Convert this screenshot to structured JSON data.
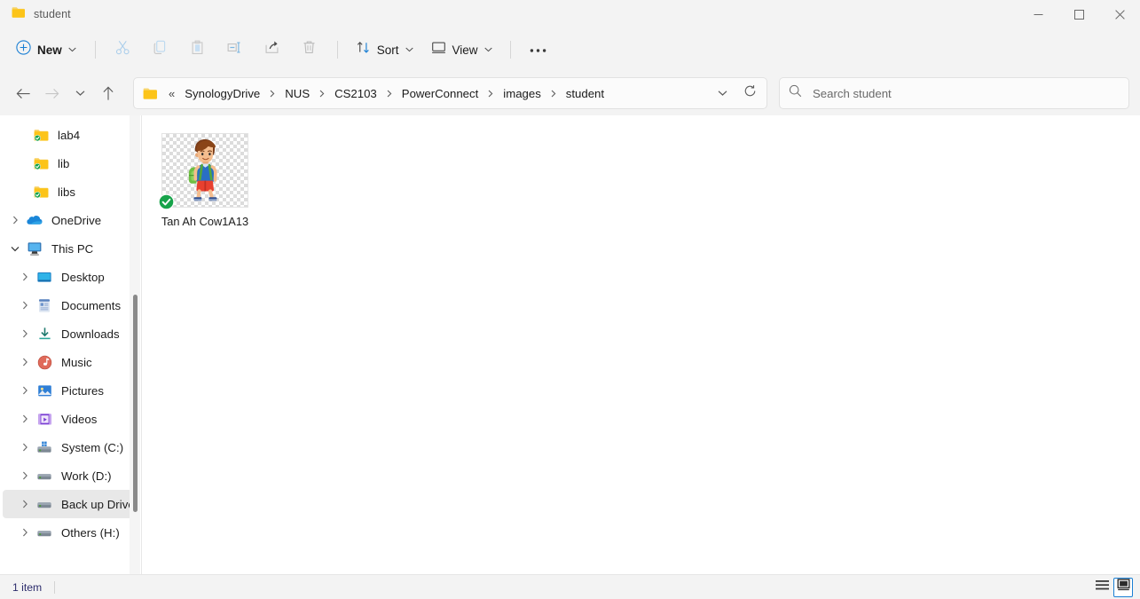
{
  "window": {
    "title": "student",
    "folder_icon": "folder-icon",
    "controls": [
      {
        "name": "minimize",
        "glyph": "—"
      },
      {
        "name": "maximize",
        "glyph": "☐"
      },
      {
        "name": "close",
        "glyph": "✕"
      }
    ]
  },
  "toolbar": {
    "new_label": "New",
    "new_icon": "circle-plus-icon",
    "items": [
      {
        "name": "cut",
        "icon": "scissors-icon",
        "label": "Cut"
      },
      {
        "name": "copy",
        "icon": "copy-icon",
        "label": "Copy"
      },
      {
        "name": "paste",
        "icon": "paste-icon",
        "label": "Paste"
      },
      {
        "name": "rename",
        "icon": "rename-icon",
        "label": "Rename"
      },
      {
        "name": "share",
        "icon": "share-icon",
        "label": "Share"
      },
      {
        "name": "delete",
        "icon": "trash-icon",
        "label": "Delete"
      }
    ],
    "sort_label": "Sort",
    "sort_icon": "sort-arrows-icon",
    "view_label": "View",
    "view_icon": "monitor-icon",
    "more_label": "See more",
    "more_icon": "ellipsis-icon"
  },
  "navigation": {
    "back": {
      "name": "back",
      "enabled": true
    },
    "forward": {
      "name": "forward",
      "enabled": false
    },
    "recent": {
      "name": "recent-locations",
      "enabled": true
    },
    "up": {
      "name": "up-one-level",
      "enabled": true
    }
  },
  "address": {
    "folder_icon": "folder-icon",
    "overflow": "«",
    "crumbs": [
      "SynologyDrive",
      "NUS",
      "CS2103",
      "PowerConnect",
      "images",
      "student"
    ],
    "separator": "›",
    "dropdown_icon": "chevron-down-icon",
    "refresh_icon": "refresh-icon"
  },
  "search": {
    "icon": "search-icon",
    "placeholder": "Search student",
    "value": ""
  },
  "sidebar": {
    "items": [
      {
        "label": "lab4",
        "icon": "folder-sync-icon",
        "indent": 2,
        "twisty": "none",
        "state": "normal"
      },
      {
        "label": "lib",
        "icon": "folder-sync-icon",
        "indent": 2,
        "twisty": "none",
        "state": "normal"
      },
      {
        "label": "libs",
        "icon": "folder-sync-icon",
        "indent": 2,
        "twisty": "none",
        "state": "normal"
      },
      {
        "label": "OneDrive",
        "icon": "onedrive-cloud-icon",
        "indent": 0,
        "twisty": "collapsed",
        "state": "normal"
      },
      {
        "label": "This PC",
        "icon": "this-pc-icon",
        "indent": 0,
        "twisty": "expanded",
        "state": "normal"
      },
      {
        "label": "Desktop",
        "icon": "desktop-icon",
        "indent": 1,
        "twisty": "collapsed",
        "state": "normal"
      },
      {
        "label": "Documents",
        "icon": "documents-icon",
        "indent": 1,
        "twisty": "collapsed",
        "state": "normal"
      },
      {
        "label": "Downloads",
        "icon": "downloads-icon",
        "indent": 1,
        "twisty": "collapsed",
        "state": "normal"
      },
      {
        "label": "Music",
        "icon": "music-icon",
        "indent": 1,
        "twisty": "collapsed",
        "state": "normal"
      },
      {
        "label": "Pictures",
        "icon": "pictures-icon",
        "indent": 1,
        "twisty": "collapsed",
        "state": "normal"
      },
      {
        "label": "Videos",
        "icon": "videos-icon",
        "indent": 1,
        "twisty": "collapsed",
        "state": "normal"
      },
      {
        "label": "System (C:)",
        "icon": "system-drive-icon",
        "indent": 1,
        "twisty": "collapsed",
        "state": "normal"
      },
      {
        "label": "Work (D:)",
        "icon": "drive-icon",
        "indent": 1,
        "twisty": "collapsed",
        "state": "normal"
      },
      {
        "label": "Back up Drive (E:)",
        "icon": "drive-icon",
        "indent": 1,
        "twisty": "collapsed",
        "state": "hovered"
      },
      {
        "label": "Others (H:)",
        "icon": "drive-icon",
        "indent": 1,
        "twisty": "collapsed",
        "state": "normal"
      }
    ]
  },
  "files": [
    {
      "name": "Tan Ah Cow1A13",
      "thumbnail": "student-boy-backpack-image",
      "sync_badge": "green-check-sync-icon",
      "transparent_background": true
    }
  ],
  "statusbar": {
    "item_count": "1 item",
    "views": [
      {
        "name": "details-view",
        "icon": "details-view-icon",
        "active": false
      },
      {
        "name": "large-icons-view",
        "icon": "large-icons-view-icon",
        "active": true
      }
    ]
  },
  "colors": {
    "accent": "#1a7fd4",
    "chrome": "#f3f3f3",
    "content": "#ffffff",
    "sync_green": "#17a34a",
    "folder_yellow": "#ffca28",
    "status_text": "#2b2b6b"
  }
}
